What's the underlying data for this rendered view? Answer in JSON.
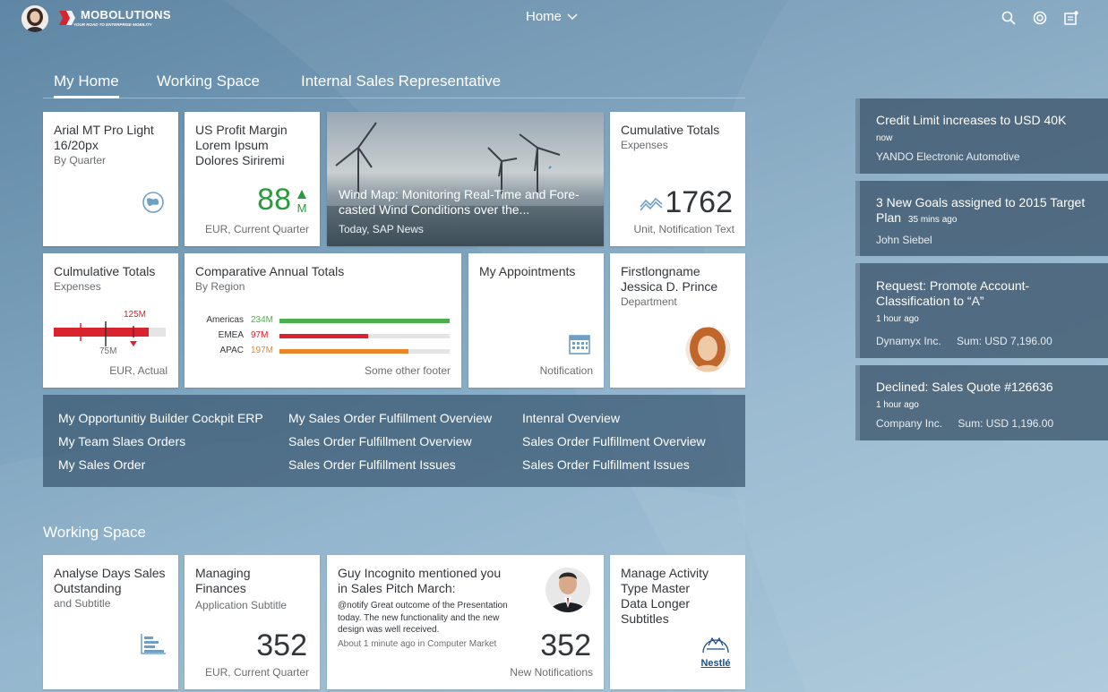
{
  "header": {
    "brand": "MOBOLUTIONS",
    "brand_tagline": "YOUR ROAD TO ENTERPRISE MOBILITY",
    "menu_label": "Home"
  },
  "tabs": [
    "My Home",
    "Working Space",
    "Internal Sales Representative"
  ],
  "tiles": {
    "t1": {
      "title": "Arial MT Pro Light 16/20px",
      "subtitle": "By Quarter",
      "icon": "globe-icon"
    },
    "t2": {
      "title": "US Profit Margin Lorem Ipsum Dolores Siriremi",
      "value": "88",
      "unit": "M",
      "trend": "up",
      "footer": "EUR, Current Quarter",
      "accent": "#2b9a3f"
    },
    "t3": {
      "title": "Wind Map: Monitoring Real-Time and Fore-casted Wind Conditions over the...",
      "footer": "Today, SAP News"
    },
    "t4": {
      "title": "Cumulative Totals",
      "subtitle": "Expenses",
      "value": "1762",
      "footer": "Unit, Notification Text",
      "icon": "line-chart-icon"
    },
    "t5": {
      "title": "Culmulative Totals",
      "subtitle": "Expenses",
      "target_label": "125M",
      "actual_label": "75M",
      "footer": "EUR, Actual"
    },
    "t6": {
      "title": "Comparative Annual Totals",
      "subtitle": "By Region",
      "footer": "Some other footer",
      "rows": [
        {
          "label": "Americas",
          "value": "234M",
          "fraction": 1.0,
          "color": "#4caf50"
        },
        {
          "label": "EMEA",
          "value": "97M",
          "fraction": 0.52,
          "color": "#d9232e"
        },
        {
          "label": "APAC",
          "value": "197M",
          "fraction": 0.76,
          "color": "#e8862a"
        }
      ]
    },
    "t7": {
      "title": "My Appointments",
      "footer": "Notification",
      "icon": "calendar-icon"
    },
    "t8": {
      "title": "Firstlongname Jessica D. Prince",
      "subtitle": "Department"
    },
    "w1": {
      "title": "Analyse Days Sales Outstanding",
      "subtitle": "and Subtitle",
      "icon": "bar-chart-icon"
    },
    "w2": {
      "title": "Managing Finances",
      "subtitle": "Application Subtitle",
      "value": "352",
      "footer": "EUR, Current Quarter"
    },
    "w3": {
      "title": "Guy Incognito mentioned you in Sales Pitch March:",
      "body": "@notify Great outcome of the Presentation today. The new functionality and the new design was well received.",
      "meta": "About 1 minute ago in Computer Market",
      "value": "352",
      "footer": "New Notifications"
    },
    "w4": {
      "title": "Manage Activity Type Master Data Longer Subtitles",
      "logo_text": "Nestlé"
    }
  },
  "links": [
    [
      "My Opportunitiy Builder Cockpit ERP",
      "My Team Slaes Orders",
      "My Sales Order"
    ],
    [
      "My Sales Order Fulfillment Overview",
      "Sales Order Fulfillment Overview",
      "Sales Order Fulfillment Issues"
    ],
    [
      "Intenral Overview",
      "Sales Order Fulfillment Overview",
      "Sales Order Fulfillment Issues"
    ]
  ],
  "section2_title": "Working Space",
  "notifications": [
    {
      "title": "Credit Limit increases to USD 40K",
      "time": "now",
      "from": "YANDO Electronic Automotive",
      "sum": ""
    },
    {
      "title": "3 New Goals assigned to 2015 Target Plan",
      "time": "35 mins ago",
      "from": "John Siebel",
      "sum": ""
    },
    {
      "title": "Request: Promote Account-Classification to “A”",
      "time": "1 hour ago",
      "from": "Dynamyx Inc.",
      "sum": "Sum: USD 7,196.00"
    },
    {
      "title": "Declined: Sales Quote #126636",
      "time": "1 hour ago",
      "from": "Company Inc.",
      "sum": "Sum: USD 1,196.00"
    }
  ]
}
